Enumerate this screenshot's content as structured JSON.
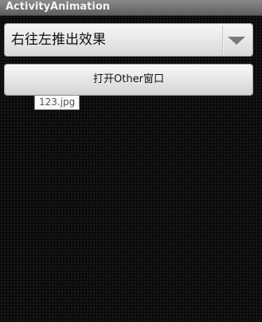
{
  "app": {
    "title": "ActivityAnimation"
  },
  "spinner": {
    "selected": "右往左推出效果",
    "arrow_icon": "chevron-down-icon"
  },
  "actions": {
    "open_other_label": "打开Other窗口"
  },
  "tooltip": {
    "text": "123.jpg"
  }
}
